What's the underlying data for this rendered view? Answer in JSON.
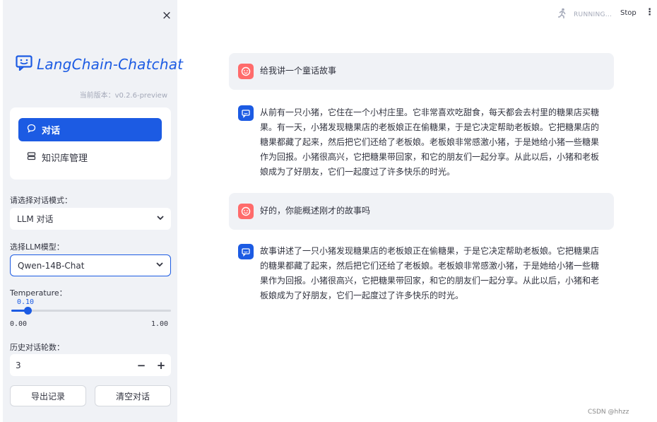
{
  "sidebar": {
    "close_label": "×",
    "logo_text": "LangChain-Chatchat",
    "version": "当前版本：v0.2.6-preview",
    "nav": [
      {
        "label": "对话",
        "icon": "chat-bubble-icon",
        "active": true
      },
      {
        "label": "知识库管理",
        "icon": "database-icon",
        "active": false
      }
    ],
    "mode_label": "请选择对话模式：",
    "mode_value": "LLM 对话",
    "model_label": "选择LLM模型：",
    "model_value": "Qwen-14B-Chat",
    "temperature_label": "Temperature：",
    "temperature_value": "0.10",
    "temperature_min": "0.00",
    "temperature_max": "1.00",
    "temperature_fraction": 0.1,
    "history_label": "历史对话轮数：",
    "history_value": "3",
    "minus": "−",
    "plus": "+",
    "export_button": "导出记录",
    "clear_button": "清空对话"
  },
  "topbar": {
    "status": "RUNNING...",
    "stop": "Stop",
    "menu": "⋮"
  },
  "messages": [
    {
      "role": "user",
      "text": "给我讲一个童话故事"
    },
    {
      "role": "assistant",
      "text": "从前有一只小猪，它住在一个小村庄里。它非常喜欢吃甜食，每天都会去村里的糖果店买糖果。有一天，小猪发现糖果店的老板娘正在偷糖果，于是它决定帮助老板娘。它把糖果店的糖果都藏了起来，然后把它们还给了老板娘。老板娘非常感激小猪，于是她给小猪一些糖果作为回报。小猪很高兴，它把糖果带回家，和它的朋友们一起分享。从此以后，小猪和老板娘成为了好朋友，它们一起度过了许多快乐的时光。"
    },
    {
      "role": "user",
      "text": "好的，你能概述刚才的故事吗"
    },
    {
      "role": "assistant",
      "text": "故事讲述了一只小猪发现糖果店的老板娘正在偷糖果，于是它决定帮助老板娘。它把糖果店的糖果都藏了起来，然后把它们还给了老板娘。老板娘非常感激小猪，于是她给小猪一些糖果作为回报。小猪很高兴，它把糖果带回家，和它的朋友们一起分享。从此以后，小猪和老板娘成为了好朋友，它们一起度过了许多快乐的时光。"
    }
  ],
  "watermark": "CSDN @hhzz",
  "colors": {
    "accent": "#1c5be3",
    "user_avatar": "#ff6b6b",
    "sidebar_bg": "#f0f2f6"
  }
}
